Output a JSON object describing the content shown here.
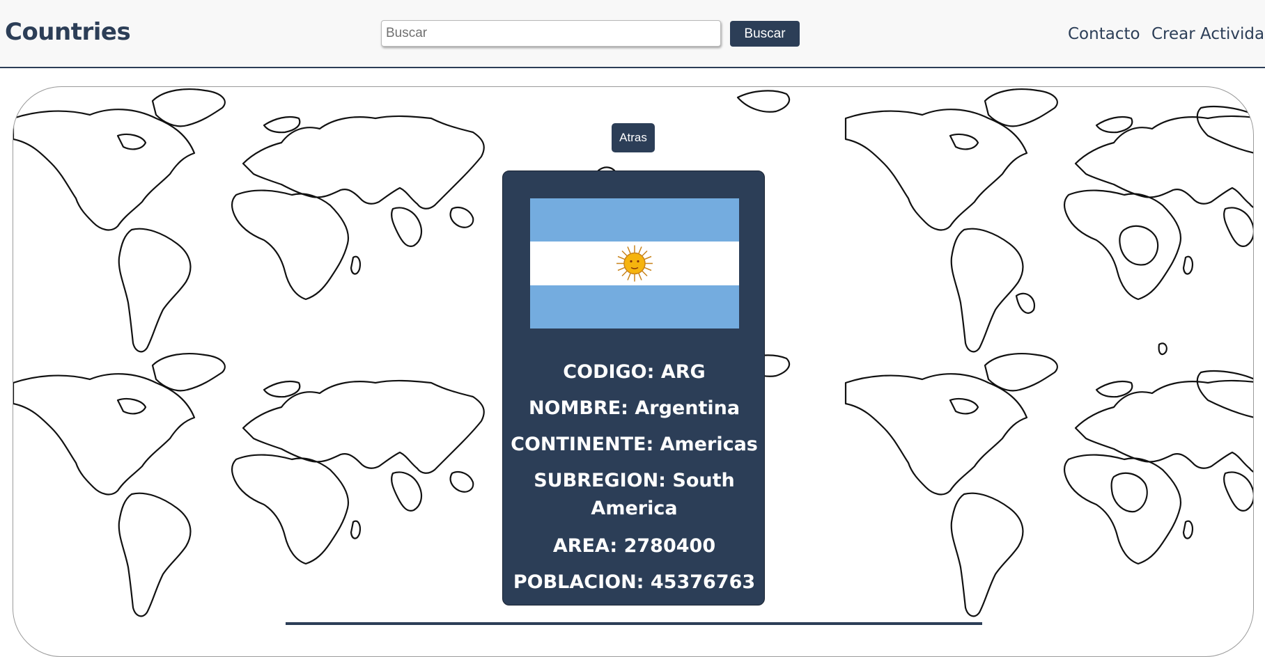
{
  "header": {
    "brand": "Countries",
    "search": {
      "placeholder": "Buscar",
      "value": ""
    },
    "search_button": "Buscar",
    "nav": [
      "Contacto",
      "Crear Actividad"
    ]
  },
  "back_button": "Atras",
  "country": {
    "flag_icon": "argentina-flag",
    "fields": [
      {
        "label": "CODIGO:",
        "value": "ARG"
      },
      {
        "label": "NOMBRE:",
        "value": "Argentina"
      },
      {
        "label": "CONTINENTE:",
        "value": "Americas"
      },
      {
        "label": "SUBREGION:",
        "value": "South America"
      },
      {
        "label": "AREA:",
        "value": "2780400"
      },
      {
        "label": "POBLACION:",
        "value": "45376763"
      }
    ]
  },
  "colors": {
    "primary": "#2c3e57",
    "flag_blue": "#74acdf",
    "sun": "#f6b40e"
  }
}
